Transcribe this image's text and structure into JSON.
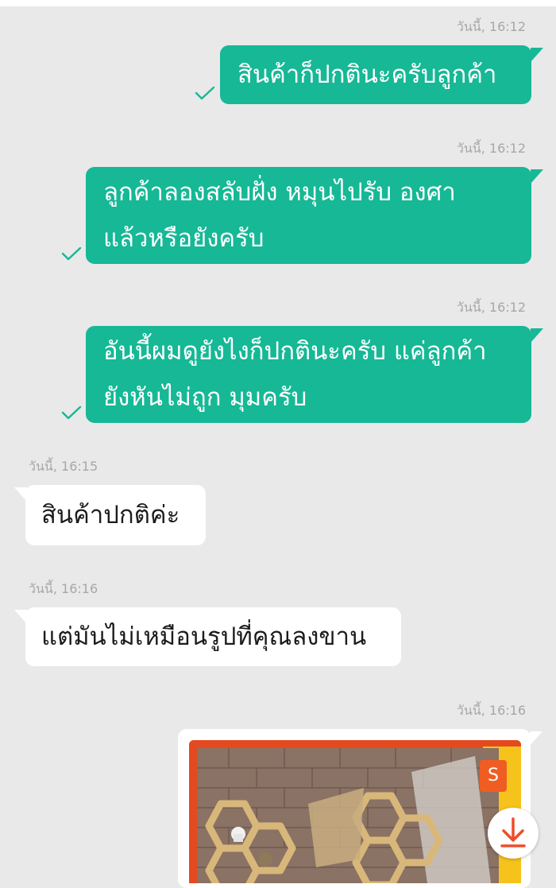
{
  "messages": [
    {
      "time": "วันนี้, 16:12",
      "text_lines": [
        "สินค้าก็ปกตินะครับลูกค้า"
      ],
      "direction": "outgoing",
      "status": "sent"
    },
    {
      "time": "วันนี้, 16:12",
      "text_lines": [
        "ลูกค้าลองสลับฝั่ง หมุนไปรับ องศา",
        "แล้วหรือยังครับ"
      ],
      "direction": "outgoing",
      "status": "sent"
    },
    {
      "time": "วันนี้, 16:12",
      "text_lines": [
        "อันนี้ผมดูยังไงก็ปกตินะครับ แค่ลูกค้า",
        "ยังหันไม่ถูก มุมครับ"
      ],
      "direction": "outgoing",
      "status": "sent"
    },
    {
      "time": "วันนี้, 16:15",
      "text_lines": [
        "สินค้าปกติค่ะ"
      ],
      "direction": "incoming"
    },
    {
      "time": "วันนี้, 16:16",
      "text_lines": [
        "แต่มันไม่เหมือนรูปที่คุณลงขาน"
      ],
      "direction": "incoming"
    },
    {
      "time": "วันนี้, 16:16",
      "direction": "outgoing",
      "type": "image",
      "image_badge": "S"
    }
  ],
  "colors": {
    "outgoing_bubble": "#16b896",
    "incoming_bubble": "#ffffff",
    "background": "#e9e9e9",
    "timestamp": "#a7a7a7",
    "check": "#16b896",
    "download_icon": "#ee4d2d"
  },
  "icons": [
    "check-icon",
    "download-icon",
    "shop-badge-icon"
  ]
}
